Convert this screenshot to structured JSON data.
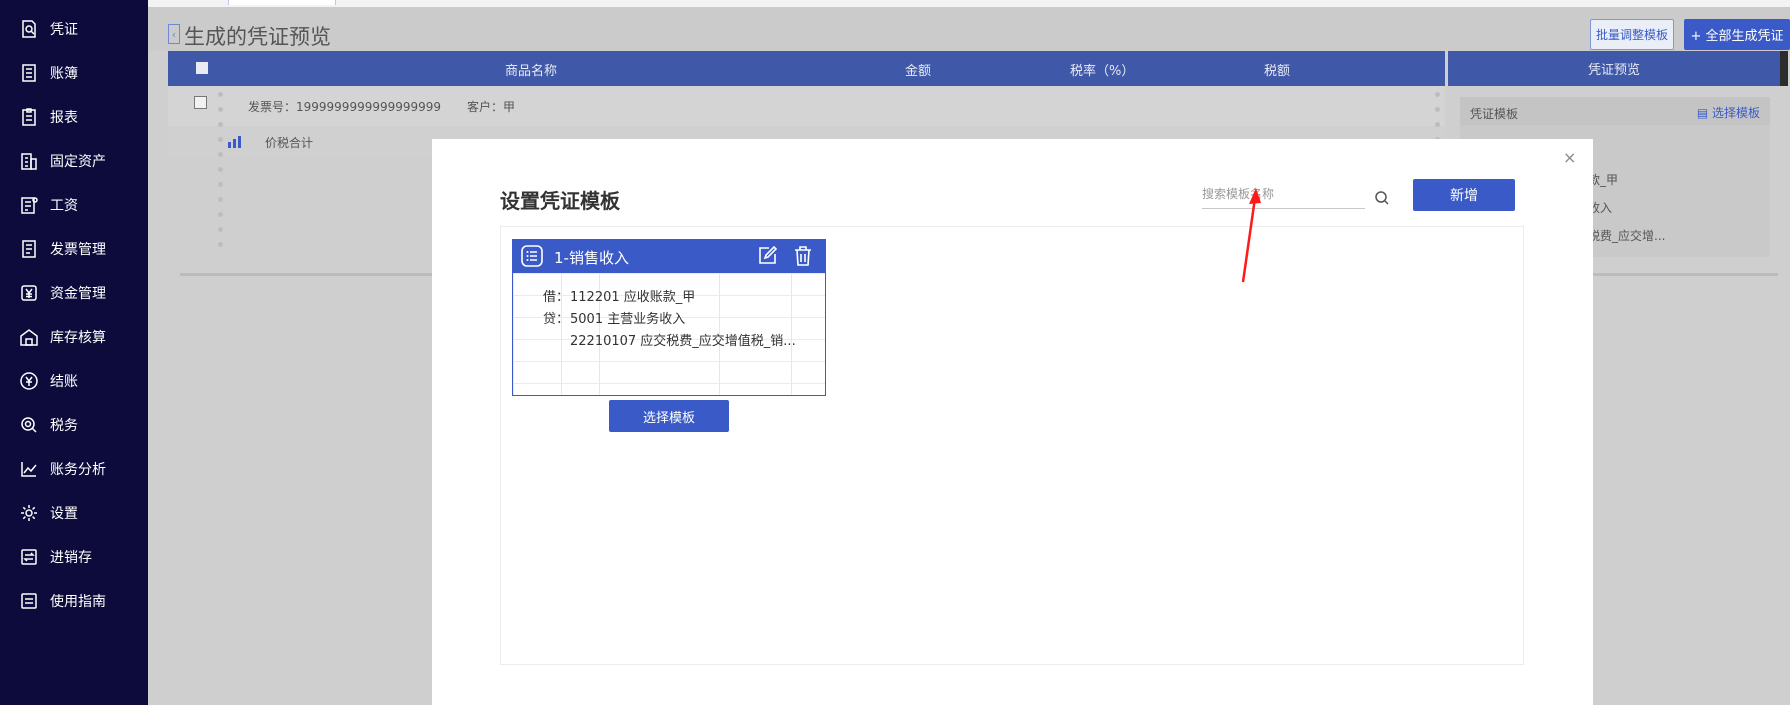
{
  "sidebar": {
    "items": [
      {
        "label": "凭证",
        "icon": "voucher-search-icon"
      },
      {
        "label": "账簿",
        "icon": "ledger-icon"
      },
      {
        "label": "报表",
        "icon": "report-icon"
      },
      {
        "label": "固定资产",
        "icon": "building-icon"
      },
      {
        "label": "工资",
        "icon": "salary-icon"
      },
      {
        "label": "发票管理",
        "icon": "invoice-icon"
      },
      {
        "label": "资金管理",
        "icon": "yuan-icon"
      },
      {
        "label": "库存核算",
        "icon": "warehouse-icon"
      },
      {
        "label": "结账",
        "icon": "yuan-circle-icon"
      },
      {
        "label": "税务",
        "icon": "tax-icon"
      },
      {
        "label": "账务分析",
        "icon": "chart-line-icon"
      },
      {
        "label": "设置",
        "icon": "gear-icon"
      },
      {
        "label": "进销存",
        "icon": "transfer-icon"
      },
      {
        "label": "使用指南",
        "icon": "guide-icon"
      }
    ]
  },
  "header": {
    "title": "生成的凭证预览",
    "batch_button": "批量调整模板",
    "generate_button": "+ 全部生成凭证"
  },
  "table": {
    "columns": [
      "商品名称",
      "金额",
      "税率（%）",
      "税额"
    ],
    "invoice_no": "发票号：1999999999999999999",
    "customer": "客户：甲",
    "subtotal_label": "价税合计"
  },
  "preview": {
    "header": "凭证预览",
    "template_label": "凭证模板",
    "select_template": "选择模板",
    "lines": [
      "款_甲",
      "收入",
      "税费_应交增..."
    ]
  },
  "modal": {
    "title": "设置凭证模板",
    "close": "×",
    "search_placeholder": "搜索模板名称",
    "add_button": "新增",
    "templates": [
      {
        "name": "1-销售收入",
        "debit_label": "借：",
        "debit": "112201 应收账款_甲",
        "credit_label": "贷：",
        "credit1": "5001 主营业务收入",
        "credit2": "22210107 应交税费_应交增值税_销...",
        "choose_button": "选择模板"
      }
    ]
  },
  "colors": {
    "sidebar_bg": "#0c0b3c",
    "primary": "#3a5bc7",
    "annotation_arrow": "#ff1a1a"
  }
}
